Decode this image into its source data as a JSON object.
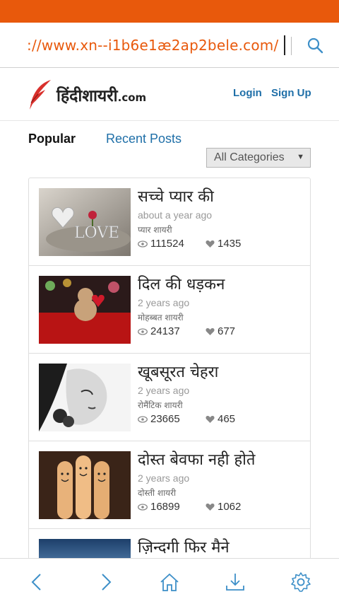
{
  "browser": {
    "url": "://www.xn--i1b6e1æ2ap2bele.com/",
    "search_icon": "search-icon"
  },
  "site": {
    "logo_text": "हिंदीशायरी",
    "logo_suffix": ".com",
    "login": "Login",
    "signup": "Sign Up"
  },
  "tabs": {
    "popular": "Popular",
    "recent": "Recent Posts"
  },
  "category_select": {
    "value": "All Categories"
  },
  "posts": [
    {
      "title": "सच्चे प्यार की",
      "time": "about a year ago",
      "category": "प्यार शायरी",
      "views": "111524",
      "likes": "1435"
    },
    {
      "title": "दिल की धड़कन",
      "time": "2 years ago",
      "category": "मोहब्बत शायरी",
      "views": "24137",
      "likes": "677"
    },
    {
      "title": "खूबसूरत चेहरा",
      "time": "2 years ago",
      "category": "रोमैंटिक शायरी",
      "views": "23665",
      "likes": "465"
    },
    {
      "title": "दोस्त बेवफा नही होते",
      "time": "2 years ago",
      "category": "दोस्ती शायरी",
      "views": "16899",
      "likes": "1062"
    },
    {
      "title": "ज़िन्दगी फिर मैने",
      "time": "",
      "category": "",
      "views": "",
      "likes": ""
    }
  ],
  "nav": {
    "back": "chevron-left-icon",
    "forward": "chevron-right-icon",
    "home": "home-icon",
    "download": "download-icon",
    "settings": "gear-icon"
  },
  "colors": {
    "accent_orange": "#e8590c",
    "link_blue": "#1f6fa8",
    "nav_blue": "#3d8fc8"
  }
}
